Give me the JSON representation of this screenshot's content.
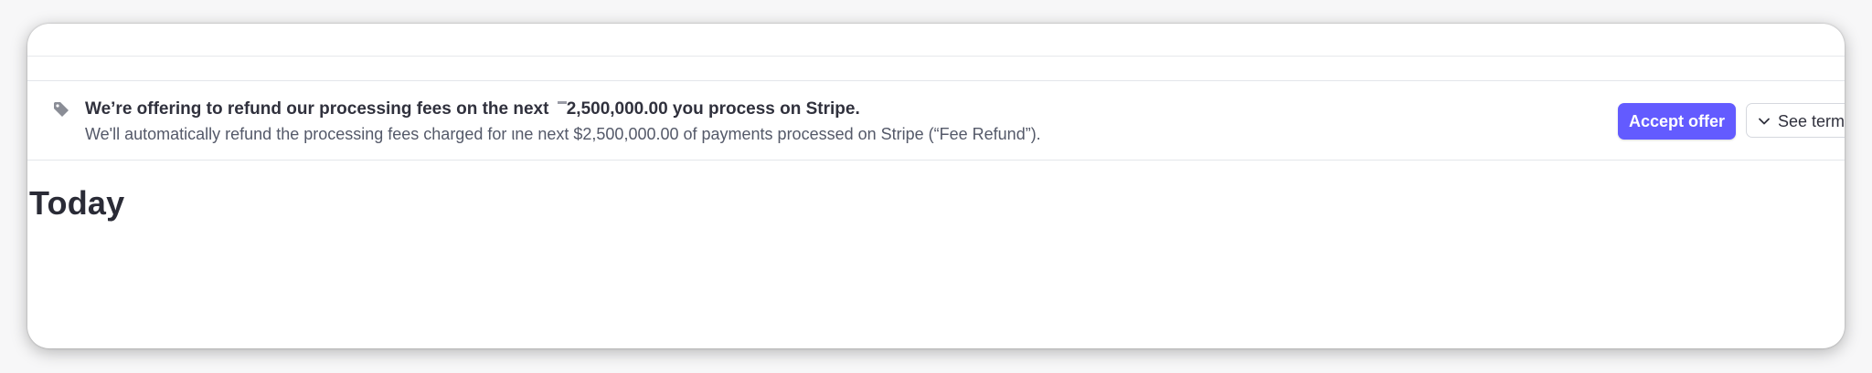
{
  "banner": {
    "title_prefix": "We’re offering to refund our processing fees on the next ",
    "title_amount": "2,500,000.00 you process on Stripe.",
    "description": "We'll automatically refund the processing fees charged for ιne next  $2,500,000.00 of payments processed on Stripe (“Fee Refund”).",
    "accept_label": "Accept offer",
    "terms_label": "See terms",
    "icon": "tag-icon"
  },
  "main": {
    "section_title": "Today"
  },
  "colors": {
    "accent": "#635bff",
    "text_primary": "#30313d",
    "text_secondary": "#545969",
    "divider": "#e3e6ea"
  }
}
